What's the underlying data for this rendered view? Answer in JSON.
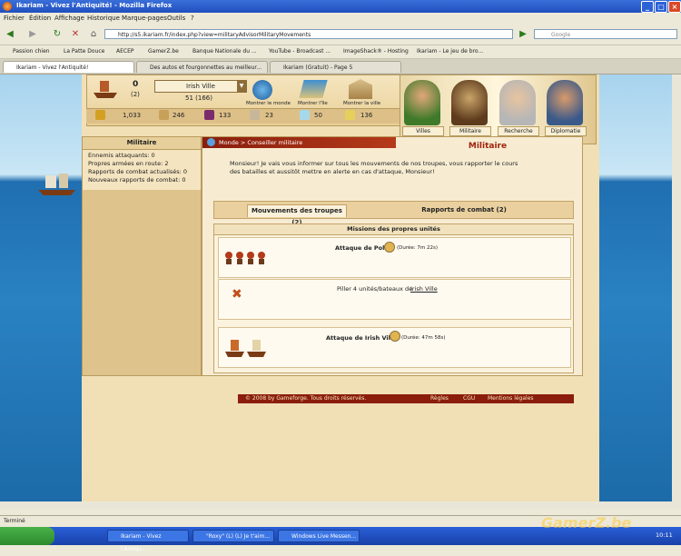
{
  "window": {
    "title": "Ikariam - Vivez l'Antiquité! - Mozilla Firefox"
  },
  "menu": [
    "Fichier",
    "Édition",
    "Affichage",
    "Historique",
    "Marque-pages",
    "Outils",
    "?"
  ],
  "nav": {
    "url": "http://s5.ikariam.fr/index.php?view=militaryAdvisorMilitaryMovements",
    "search_placeholder": "Google"
  },
  "bookmarks": [
    "Passion chien",
    "La Patte Douce",
    "AECEP",
    "GamerZ.be",
    "Banque Nationale du ...",
    "YouTube - Broadcast ...",
    "ImageShack® - Hosting",
    "Ikariam - Le jeu de bro..."
  ],
  "tabs": [
    "Ikariam - Vivez l'Antiquité!",
    "Des autos et fourgonnettes au meilleur...",
    "Ikariam (Gratuit) - Page 5"
  ],
  "game": {
    "ships": {
      "value": "0",
      "sub": "(2)"
    },
    "city": {
      "name": "Irish Ville",
      "population": "51 (166)"
    },
    "buttons": [
      "Montrer le monde",
      "Montrer l'île",
      "Montrer la ville"
    ],
    "resources": [
      "1,033",
      "246",
      "133",
      "23",
      "50",
      "136"
    ],
    "advisors": [
      "Villes",
      "Militaire",
      "Recherche",
      "Diplomatie"
    ],
    "sidebar": {
      "title": "Militaire",
      "lines": [
        "Ennemis attaquants: 0",
        "Propres armées en route: 2",
        "Rapports de combat actualisés: 0",
        "Nouveaux rapports de combat: 0"
      ]
    },
    "breadcrumb": "Monde > Conseiller militaire",
    "main_title": "Militaire",
    "intro": "Monsieur! Je vais vous informer sur tous les mouvements de nos troupes, vous rapporter le cours des batailles et aussitôt mettre en alerte en cas d'attaque, Monsieur!",
    "tab_movements": "Mouvements des troupes (2)",
    "tab_reports": "Rapports de combat (2)",
    "missions_header": "Missions des propres unités",
    "missions": [
      {
        "label": "Attaque de Polis",
        "duration": "(Durée: 7m 22s)"
      },
      {
        "label_prefix": "Piller 4 unités/bateaux de",
        "label_link": "Irish Ville"
      },
      {
        "label": "Attaque de Irish Ville",
        "duration": "(Durée: 47m 58s)"
      }
    ],
    "footer": {
      "copyright": "© 2008 by Gameforge. Tous droits réservés.",
      "links": [
        "Règles",
        "CGU",
        "Mentions légales"
      ]
    }
  },
  "status": "Terminé",
  "taskbar": [
    "Ikariam - Vivez l'Antiqu...",
    "\"Roxy\" (L) (L) Je t'aim...",
    "Windows Live Messen..."
  ],
  "clock": "10:11",
  "watermark": "GamerZ.be"
}
